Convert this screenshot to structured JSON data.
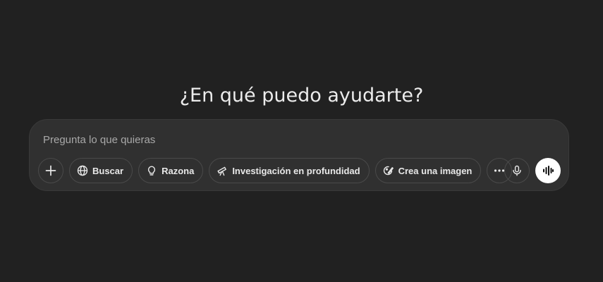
{
  "heading": "¿En qué puedo ayudarte?",
  "composer": {
    "placeholder": "Pregunta lo que quieras",
    "value": ""
  },
  "tools": {
    "attach_icon": "plus-icon",
    "search": {
      "label": "Buscar",
      "icon": "globe-icon"
    },
    "reason": {
      "label": "Razona",
      "icon": "lightbulb-icon"
    },
    "deep_research": {
      "label": "Investigación en profundidad",
      "icon": "telescope-icon"
    },
    "create_image": {
      "label": "Crea una imagen",
      "icon": "image-brush-icon"
    },
    "more_icon": "ellipsis-icon",
    "dictate_icon": "microphone-icon",
    "voice_mode_icon": "waveform-icon"
  },
  "colors": {
    "background": "#212121",
    "composer": "#303030",
    "text": "#ececec",
    "placeholder": "#a8a8a8",
    "voice_button": "#ffffff"
  }
}
